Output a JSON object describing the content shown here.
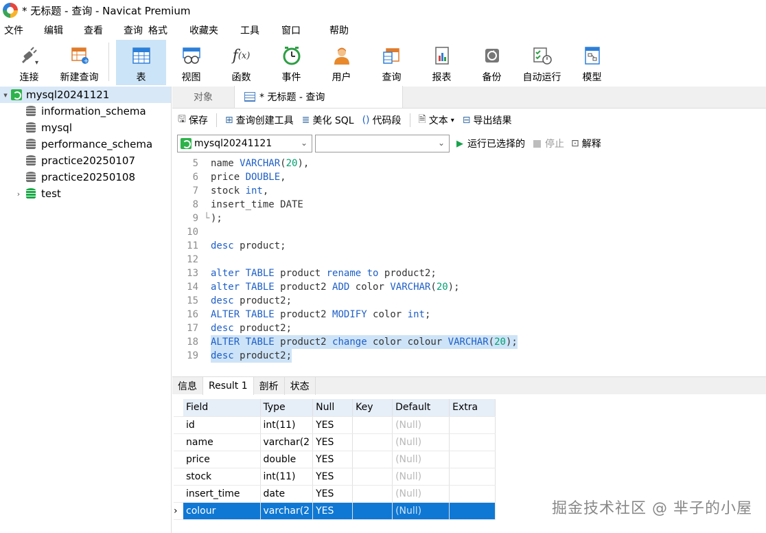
{
  "window": {
    "title": "* 无标题 - 查询 - Navicat Premium"
  },
  "menu": [
    "文件",
    "编辑",
    "查看",
    "查询",
    "格式",
    "收藏夹",
    "工具",
    "窗口",
    "帮助"
  ],
  "toolbar": [
    {
      "label": "连接",
      "icon": "plug-icon"
    },
    {
      "label": "新建查询",
      "icon": "new-query-icon"
    },
    {
      "label": "表",
      "icon": "table-icon",
      "active": true
    },
    {
      "label": "视图",
      "icon": "view-icon"
    },
    {
      "label": "函数",
      "icon": "function-icon"
    },
    {
      "label": "事件",
      "icon": "clock-icon"
    },
    {
      "label": "用户",
      "icon": "user-icon"
    },
    {
      "label": "查询",
      "icon": "query-icon"
    },
    {
      "label": "报表",
      "icon": "report-icon"
    },
    {
      "label": "备份",
      "icon": "backup-icon"
    },
    {
      "label": "自动运行",
      "icon": "autorun-icon"
    },
    {
      "label": "模型",
      "icon": "model-icon"
    }
  ],
  "tree": {
    "root": "mysql20241121",
    "items": [
      "information_schema",
      "mysql",
      "performance_schema",
      "practice20250107",
      "practice20250108"
    ],
    "last": "test"
  },
  "tabs": {
    "objects": "对象",
    "query": "* 无标题 - 查询"
  },
  "query_toolbar": {
    "save": "保存",
    "builder": "查询创建工具",
    "beautify": "美化 SQL",
    "snippet": "代码段",
    "text": "文本",
    "export": "导出结果"
  },
  "selectors": {
    "connection": "mysql20241121",
    "database": ""
  },
  "run": {
    "run_selected": "运行已选择的",
    "stop": "停止",
    "explain": "解释"
  },
  "editor": {
    "lines": [
      {
        "n": "5",
        "text": "name VARCHAR(20),"
      },
      {
        "n": "6",
        "text": "price DOUBLE,"
      },
      {
        "n": "7",
        "text": "stock int,"
      },
      {
        "n": "8",
        "text": "insert_time DATE"
      },
      {
        "n": "9",
        "text": ");"
      },
      {
        "n": "10",
        "text": ""
      },
      {
        "n": "11",
        "text": "desc product;"
      },
      {
        "n": "12",
        "text": ""
      },
      {
        "n": "13",
        "text": "alter TABLE product rename to product2;"
      },
      {
        "n": "14",
        "text": "alter TABLE product2 ADD color VARCHAR(20);"
      },
      {
        "n": "15",
        "text": "desc product2;"
      },
      {
        "n": "16",
        "text": "ALTER TABLE product2 MODIFY color int;"
      },
      {
        "n": "17",
        "text": "desc product2;"
      },
      {
        "n": "18",
        "text": "ALTER TABLE product2 change color colour VARCHAR(20);"
      },
      {
        "n": "19",
        "text": "desc product2;"
      }
    ],
    "selected_lines": [
      "18",
      "19"
    ]
  },
  "result_tabs": [
    "信息",
    "Result 1",
    "剖析",
    "状态"
  ],
  "result": {
    "columns": [
      "Field",
      "Type",
      "Null",
      "Key",
      "Default",
      "Extra"
    ],
    "rows": [
      [
        "id",
        "int(11)",
        "YES",
        "",
        "(Null)",
        ""
      ],
      [
        "name",
        "varchar(2",
        "YES",
        "",
        "(Null)",
        ""
      ],
      [
        "price",
        "double",
        "YES",
        "",
        "(Null)",
        ""
      ],
      [
        "stock",
        "int(11)",
        "YES",
        "",
        "(Null)",
        ""
      ],
      [
        "insert_time",
        "date",
        "YES",
        "",
        "(Null)",
        ""
      ],
      [
        "colour",
        "varchar(2",
        "YES",
        "",
        "(Null)",
        ""
      ]
    ],
    "selected_row": 5
  },
  "watermark": "掘金技术社区 @ 芈子的小屋"
}
